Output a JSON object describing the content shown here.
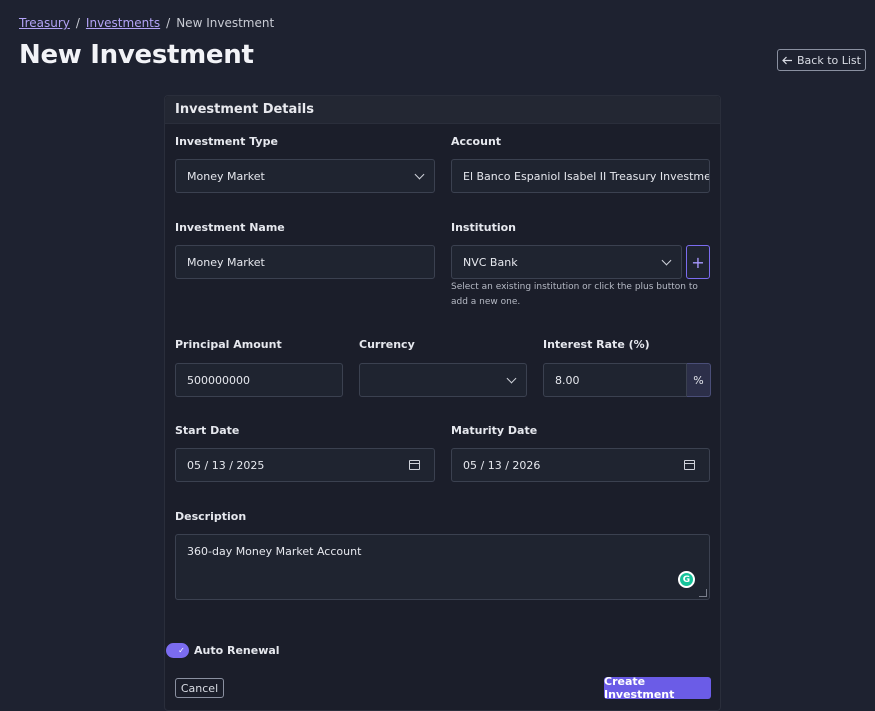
{
  "breadcrumb": {
    "items": [
      "Treasury",
      "Investments",
      "New Investment"
    ],
    "separator": "/"
  },
  "page": {
    "title": "New Investment",
    "back_label": "Back to List"
  },
  "card": {
    "title": "Investment Details"
  },
  "form": {
    "investment_type": {
      "label": "Investment Type",
      "value": "Money Market"
    },
    "account": {
      "label": "Account",
      "value": "El Banco Espaniol Isabel II Treasury Investment ("
    },
    "investment_name": {
      "label": "Investment Name",
      "value": "Money Market"
    },
    "institution": {
      "label": "Institution",
      "value": "NVC Bank",
      "add_label": "+",
      "help": "Select an existing institution or click the plus button to add a new one."
    },
    "principal_amount": {
      "label": "Principal Amount",
      "value": "500000000"
    },
    "currency": {
      "label": "Currency",
      "value": ""
    },
    "interest_rate": {
      "label": "Interest Rate (%)",
      "value": "8.00",
      "suffix": "%"
    },
    "start_date": {
      "label": "Start Date",
      "value": "05 / 13 / 2025"
    },
    "maturity_date": {
      "label": "Maturity Date",
      "value": "05 / 13 / 2026"
    },
    "description": {
      "label": "Description",
      "value": "360-day Money Market Account"
    },
    "auto_renewal": {
      "label": "Auto Renewal",
      "checked": true
    }
  },
  "actions": {
    "cancel_label": "Cancel",
    "create_label": "Create Investment"
  },
  "icons": {
    "back": "arrow-left-icon",
    "select": "chevron-down-icon",
    "date": "calendar-icon",
    "toggle_check": "check-icon",
    "grammarly": "grammarly-icon"
  },
  "colors": {
    "background": "#1e2230",
    "accent": "#6b5ce7",
    "link": "#b3a3f7"
  }
}
